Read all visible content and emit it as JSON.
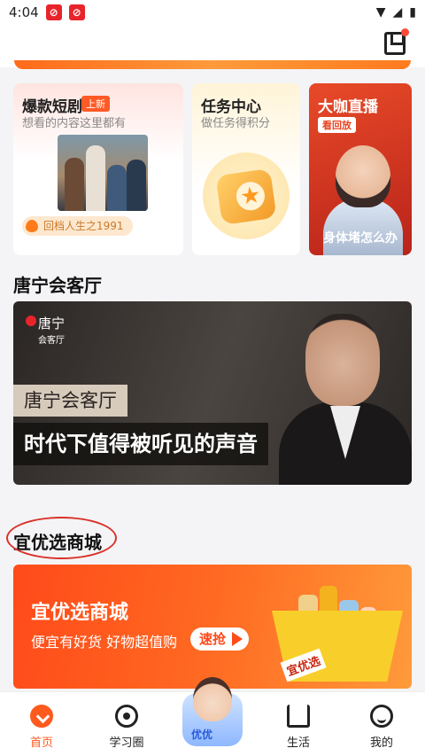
{
  "status_bar": {
    "time": "4:04",
    "notif_icon": "app-notification-icon"
  },
  "header": {
    "bookmark_icon": "bookmark-icon"
  },
  "cards": {
    "drama": {
      "title": "爆款短剧",
      "badge": "上新",
      "subtitle": "想看的内容这里都有",
      "tag": "回档人生之1991"
    },
    "task": {
      "title": "任务中心",
      "subtitle": "做任务得积分"
    },
    "live": {
      "title": "大咖直播",
      "badge": "看回放",
      "caption": "身体堵怎么办"
    }
  },
  "tangning": {
    "section_title": "唐宁会客厅",
    "logo": "唐宁",
    "logo_sub": "会客厅",
    "label": "唐宁会客厅",
    "slogan": "时代下值得被听见的声音"
  },
  "mall": {
    "section_title": "宜优选商城",
    "title": "宜优选商城",
    "subtitle": "便宜有好货 好物超值购",
    "button": "速抢",
    "cart_label": "宜优选"
  },
  "tabbar": {
    "home": "首页",
    "learn": "学习圈",
    "assistant": "优优",
    "life": "生活",
    "me": "我的"
  },
  "colors": {
    "accent": "#ff5a1e",
    "annotation": "#d8322a"
  }
}
